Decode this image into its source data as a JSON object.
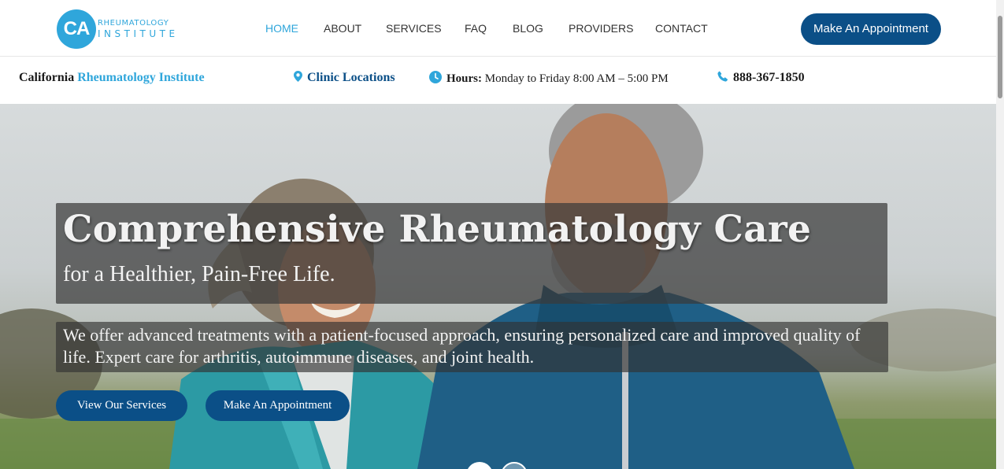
{
  "colors": {
    "brand_blue": "#2fa6db",
    "button_navy": "#0b4f87"
  },
  "logo": {
    "badge": "CA",
    "line1": "RHEUMATOLOGY",
    "line2": "INSTITUTE"
  },
  "nav": {
    "items": [
      {
        "label": "HOME",
        "active": true
      },
      {
        "label": "ABOUT"
      },
      {
        "label": "SERVICES"
      },
      {
        "label": "FAQ"
      },
      {
        "label": "BLOG"
      },
      {
        "label": "PROVIDERS"
      },
      {
        "label": "CONTACT"
      }
    ],
    "cta": "Make An Appointment"
  },
  "infobar": {
    "brand_plain": "California",
    "brand_highlight": "Rheumatology Institute",
    "locations": "Clinic Locations",
    "hours_label": "Hours:",
    "hours_value": "Monday to Friday 8:00 AM – 5:00 PM",
    "phone": "888-367-1850",
    "icons": [
      "map-pin-icon",
      "clock-icon",
      "phone-icon"
    ]
  },
  "hero": {
    "title": "Comprehensive Rheumatology Care",
    "subtitle": "for a Healthier, Pain-Free Life.",
    "body": "We offer advanced treatments with a patient-focused approach, ensuring personalized care and improved quality of life. Expert care for arthritis, autoimmune diseases, and joint health.",
    "buttons": [
      "View Our Services",
      "Make An Appointment"
    ],
    "slides": {
      "count": 2,
      "active": 1
    }
  }
}
